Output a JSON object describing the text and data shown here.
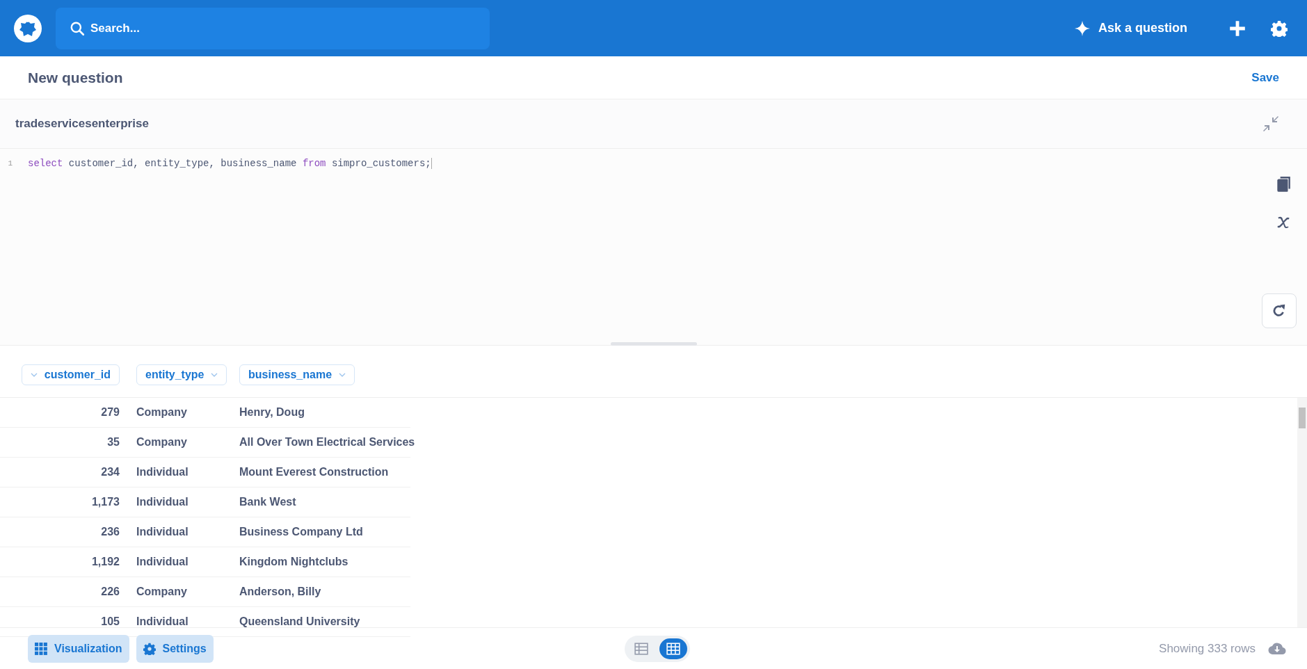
{
  "topbar": {
    "search_placeholder": "Search...",
    "ask_label": "Ask a question"
  },
  "header": {
    "title": "New question",
    "save_label": "Save"
  },
  "database": {
    "name": "tradeservicesenterprise"
  },
  "editor": {
    "lines": [
      {
        "number": "1",
        "tokens": [
          {
            "kind": "keyword",
            "text": "select"
          },
          {
            "kind": "plain",
            "text": " customer_id, entity_type, business_name "
          },
          {
            "kind": "keyword",
            "text": "from"
          },
          {
            "kind": "plain",
            "text": " simpro_customers;"
          }
        ]
      }
    ]
  },
  "table": {
    "columns": [
      {
        "label": "customer_id",
        "kind": "number"
      },
      {
        "label": "entity_type",
        "kind": "text"
      },
      {
        "label": "business_name",
        "kind": "text"
      }
    ],
    "rows": [
      [
        "279",
        "Company",
        "Henry, Doug"
      ],
      [
        "35",
        "Company",
        "All Over Town Electrical Services"
      ],
      [
        "234",
        "Individual",
        "Mount Everest Construction"
      ],
      [
        "1,173",
        "Individual",
        "Bank West"
      ],
      [
        "236",
        "Individual",
        "Business Company Ltd"
      ],
      [
        "1,192",
        "Individual",
        "Kingdom Nightclubs"
      ],
      [
        "226",
        "Company",
        "Anderson, Billy"
      ],
      [
        "105",
        "Individual",
        "Queensland University"
      ]
    ]
  },
  "footer": {
    "buttons": [
      {
        "kind": "grid",
        "label": "Visualization"
      },
      {
        "kind": "gear",
        "label": "Settings"
      }
    ],
    "view_toggle": [
      {
        "kind": "table",
        "selected": false
      },
      {
        "kind": "grid",
        "selected": true
      }
    ],
    "row_count": "Showing 333 rows"
  }
}
